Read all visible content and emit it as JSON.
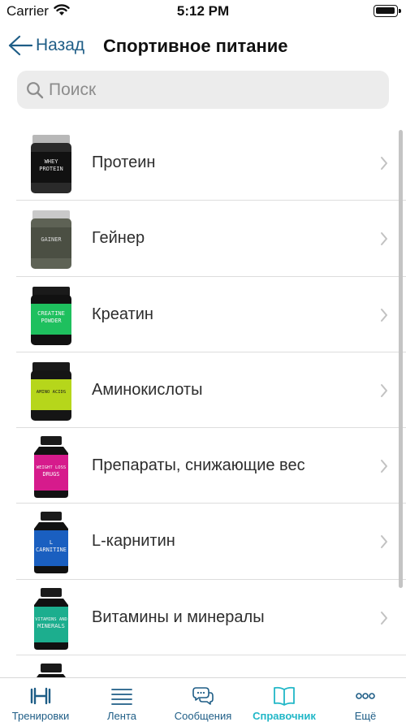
{
  "status": {
    "carrier": "Carrier",
    "time": "5:12 PM"
  },
  "nav": {
    "back_label": "Назад",
    "title": "Спортивное питание"
  },
  "search": {
    "placeholder": "Поиск",
    "value": ""
  },
  "items": [
    {
      "label": "Протеин",
      "thumb_text": [
        "WHEY",
        "PROTEIN"
      ],
      "icon": "protein-jar-icon",
      "colors": {
        "body": "#2a2a2a",
        "label": "#111111",
        "lid": "#b8b8b8",
        "text": "#e9e9e9"
      }
    },
    {
      "label": "Гейнер",
      "thumb_text": [
        "GAINER"
      ],
      "icon": "gainer-jar-icon",
      "colors": {
        "body": "#5e6255",
        "label": "#4b4f43",
        "lid": "#c9c9c9",
        "text": "#dcdcdc"
      }
    },
    {
      "label": "Креатин",
      "thumb_text": [
        "CREATINE",
        "POWDER"
      ],
      "icon": "creatine-jar-icon",
      "colors": {
        "body": "#111111",
        "label": "#1ec05e",
        "lid": "#1a1a1a",
        "text": "#f4f4f4"
      }
    },
    {
      "label": "Аминокислоты",
      "thumb_text": [
        "AMINO ACIDS"
      ],
      "icon": "amino-jar-icon",
      "colors": {
        "body": "#151515",
        "label": "#b6d61b",
        "lid": "#1a1a1a",
        "text": "#1c1c1c"
      }
    },
    {
      "label": "Препараты, снижающие вес",
      "thumb_text": [
        "WEIGHT LOSS",
        "DRUGS"
      ],
      "icon": "weight-loss-bottle-icon",
      "colors": {
        "body": "#121212",
        "label": "#d61b8c",
        "lid": "#1a1a1a",
        "text": "#f8f8f8"
      }
    },
    {
      "label": "L-карнитин",
      "thumb_text": [
        "L",
        "CARNITINE"
      ],
      "icon": "carnitine-bottle-icon",
      "colors": {
        "body": "#111111",
        "label": "#1a5fc0",
        "lid": "#1a1a1a",
        "text": "#f4f4f4"
      }
    },
    {
      "label": "Витамины и минералы",
      "thumb_text": [
        "VITAMINS AND",
        "MINERALS"
      ],
      "icon": "vitamins-bottle-icon",
      "colors": {
        "body": "#111111",
        "label": "#1cae8e",
        "lid": "#1a1a1a",
        "text": "#f4f4f4"
      }
    },
    {
      "label": "",
      "thumb_text": [],
      "icon": "bottle-icon",
      "colors": {
        "body": "#111111",
        "label": "#2a2a2a",
        "lid": "#1a1a1a",
        "text": "#f4f4f4"
      }
    }
  ],
  "tabs": [
    {
      "label": "Тренировки",
      "icon": "dumbbell-icon",
      "active": false
    },
    {
      "label": "Лента",
      "icon": "feed-lines-icon",
      "active": false
    },
    {
      "label": "Сообщения",
      "icon": "chat-bubbles-icon",
      "active": false
    },
    {
      "label": "Справочник",
      "icon": "book-icon",
      "active": true
    },
    {
      "label": "Ещё",
      "icon": "more-dots-icon",
      "active": false
    }
  ],
  "theme": {
    "accent": "#21b7c7",
    "link": "#1e5d86",
    "separator": "#dddddd"
  }
}
